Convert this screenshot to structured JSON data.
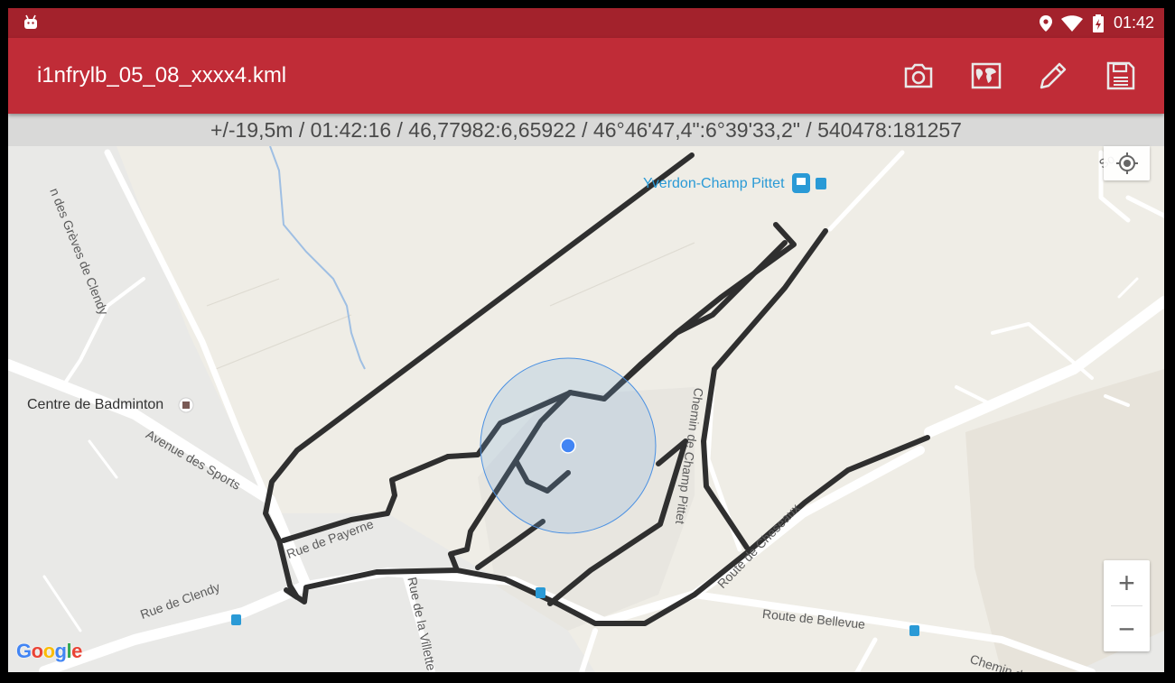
{
  "statusbar": {
    "time": "01:42",
    "icons": [
      "android-notification-icon",
      "location-icon",
      "wifi-icon",
      "battery-charging-icon"
    ]
  },
  "appbar": {
    "title": "i1nfrylb_05_08_xxxx4.kml",
    "actions": [
      "camera-icon",
      "map-icon",
      "edit-icon",
      "save-icon"
    ],
    "background_color": "#c02c37"
  },
  "info_line": "+/-19,5m / 01:42:16 / 46,77982:6,65922 / 46°46'47,4\":6°39'33,2\" / 540478:181257",
  "map": {
    "poi": {
      "badminton": "Centre de Badminton",
      "station": "Yverdon-Champ Pittet"
    },
    "streets": {
      "greves": "n des Grèves de Clendy",
      "sports": "Avenue des Sports",
      "payerne": "Rue de Payerne",
      "clendy": "Rue de Clendy",
      "villette": "Rue de la Villette",
      "champ_pittet": "Chemin de Champ Pittet",
      "cheseaux": "Route de Cheseaux",
      "bellevue": "Route de Bellevue",
      "chemin_ne": "Chemin de Ne",
      "so": "So"
    },
    "track_color": "#2f2f2f",
    "accuracy_color": "#4a90e2",
    "zoom_in": "+",
    "zoom_out": "−",
    "attribution": "Google"
  }
}
